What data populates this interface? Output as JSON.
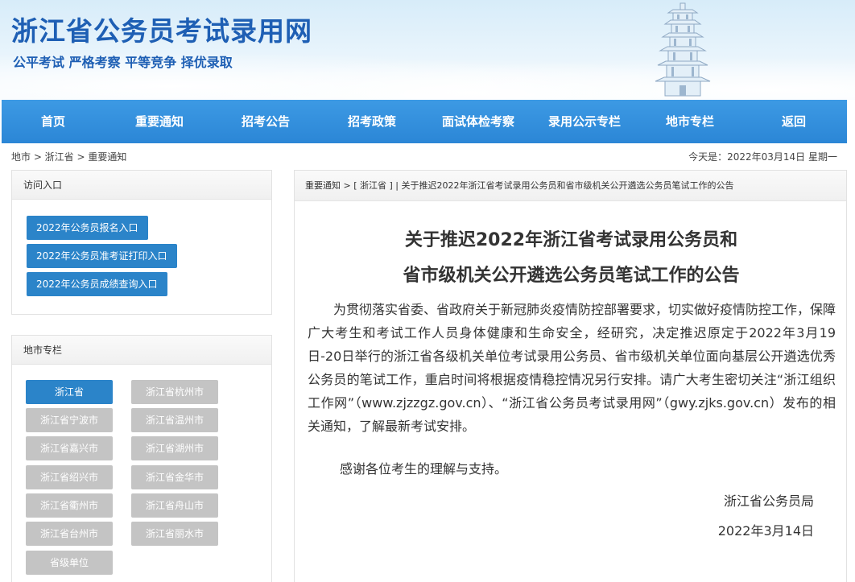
{
  "header": {
    "site_title": "浙江省公务员考试录用网",
    "slogan": "公平考试 严格考察 平等竞争 择优录取"
  },
  "nav": {
    "items": [
      "首页",
      "重要通知",
      "招考公告",
      "招考政策",
      "面试体检考察",
      "录用公示专栏",
      "地市专栏",
      "返回"
    ]
  },
  "breadcrumb": {
    "text": "地市 >  浙江省  > 重要通知"
  },
  "date_bar": {
    "text": "今天是：2022年03月14日 星期一"
  },
  "access_panel": {
    "title": "访问入口",
    "buttons": [
      "2022年公务员报名入口",
      "2022年公务员准考证打印入口",
      "2022年公务员成绩查询入口"
    ]
  },
  "city_panel": {
    "title": "地市专栏",
    "cities": [
      "浙江省",
      "浙江省杭州市",
      "浙江省宁波市",
      "浙江省温州市",
      "浙江省嘉兴市",
      "浙江省湖州市",
      "浙江省绍兴市",
      "浙江省金华市",
      "浙江省衢州市",
      "浙江省舟山市",
      "浙江省台州市",
      "浙江省丽水市",
      "省级单位"
    ],
    "active": "浙江省"
  },
  "article": {
    "crumb": "重要通知 > [ 浙江省 ] | 关于推迟2022年浙江省考试录用公务员和省市级机关公开遴选公务员笔试工作的公告",
    "title_line1": "关于推迟2022年浙江省考试录用公务员和",
    "title_line2": "省市级机关公开遴选公务员笔试工作的公告",
    "body": "为贯彻落实省委、省政府关于新冠肺炎疫情防控部署要求，切实做好疫情防控工作，保障广大考生和考试工作人员身体健康和生命安全，经研究，决定推迟原定于2022年3月19日-20日举行的浙江省各级机关单位考试录用公务员、省市级机关单位面向基层公开遴选优秀公务员的笔试工作，重启时间将根据疫情稳控情况另行安排。请广大考生密切关注“浙江组织工作网”（www.zjzzgz.gov.cn）、“浙江省公务员考试录用网”（gwy.zjks.gov.cn）发布的相关通知，了解最新考试安排。",
    "thanks": "感谢各位考生的理解与支持。",
    "signature": "浙江省公务员局",
    "date": "2022年3月14日"
  },
  "colors": {
    "brand_blue": "#1e5fb4",
    "nav_blue": "#2b86d6",
    "button_blue": "#2b84c9",
    "button_gray": "#c4c4c4"
  }
}
